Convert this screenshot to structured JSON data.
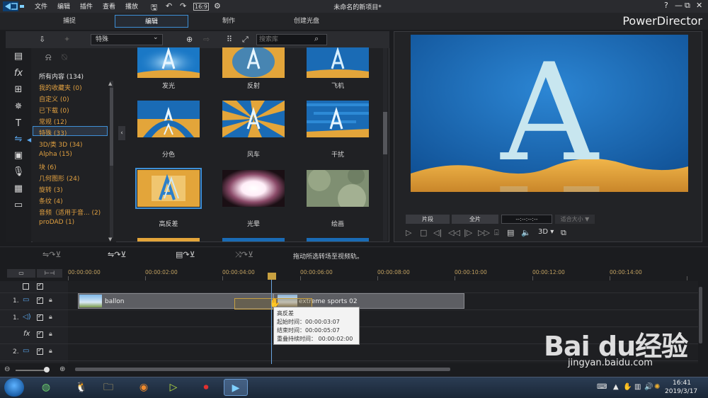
{
  "menu": {
    "items": [
      "文件",
      "编辑",
      "插件",
      "查看",
      "播放"
    ],
    "window_title": "未命名的新项目*",
    "win_controls": [
      "?",
      "—",
      "⧉",
      "✕"
    ]
  },
  "modes": {
    "tabs": [
      "捕捉",
      "编辑",
      "制作",
      "创建光盘"
    ],
    "brand": "PowerDirector"
  },
  "library": {
    "dropdown": "特殊",
    "search_placeholder": "搜索库",
    "categories": [
      {
        "label": "所有内容 (134)"
      },
      {
        "label": "我的收藏夹 (0)"
      },
      {
        "label": "自定义 (0)"
      },
      {
        "label": "已下载 (0)"
      },
      {
        "label": "常规 (12)"
      },
      {
        "label": "特殊 (33)"
      },
      {
        "label": "3D/类 3D (34)"
      },
      {
        "label": "Alpha (15)"
      },
      {
        "label": "块 (6)"
      },
      {
        "label": "几何图形 (24)"
      },
      {
        "label": "旋转 (3)"
      },
      {
        "label": "条纹 (4)"
      },
      {
        "label": "音频（适用于音... (2)"
      },
      {
        "label": "proDAD (1)"
      }
    ],
    "transitions": [
      {
        "label": "发光",
        "icon": "glow-transition-icon"
      },
      {
        "label": "反射",
        "icon": "reflection-transition-icon"
      },
      {
        "label": "飞机",
        "icon": "airplane-transition-icon"
      },
      {
        "label": "分色",
        "icon": "split-color-transition-icon"
      },
      {
        "label": "风车",
        "icon": "windmill-transition-icon"
      },
      {
        "label": "干扰",
        "icon": "interference-transition-icon"
      },
      {
        "label": "高反差",
        "icon": "high-contrast-transition-icon"
      },
      {
        "label": "光晕",
        "icon": "halo-transition-icon"
      },
      {
        "label": "绘画",
        "icon": "painting-transition-icon"
      }
    ]
  },
  "preview": {
    "letter": "A",
    "clip_btn": "片段",
    "movie_btn": "全片",
    "timecode": "--:--:--:--",
    "fit_size": "适合大小 ▼",
    "mode_3d": "3D ▾",
    "colors": {
      "sky": "#1a6bb5",
      "sand": "#e3a53a",
      "letter": "#c8e6ef"
    }
  },
  "timeline": {
    "hint": "拖动所选转场至视频轨。",
    "ruler": [
      "00:00:00:00",
      "00:00:02:00",
      "00:00:04:00",
      "00:00:06:00",
      "00:00:08:00",
      "00:00:10:00",
      "00:00:12:00",
      "00:00:14:00"
    ],
    "tracks": [
      {
        "num": "1.",
        "kind": "video"
      },
      {
        "num": "1.",
        "kind": "audio"
      },
      {
        "num": "",
        "kind": "fx"
      },
      {
        "num": "2.",
        "kind": "video"
      }
    ],
    "clip1": "ballon",
    "clip2": "extreme sports 02",
    "tooltip": {
      "title": "高反差",
      "start": "起始时间：00:00:03:07",
      "end": "结束时间：00:00:05:07",
      "overlap": "重叠持续时间： 00:00:02:00"
    }
  },
  "taskbar": {
    "time": "16:41",
    "date": "2019/3/17"
  },
  "watermark": {
    "logo": "Bai du经验",
    "url": "jingyan.baidu.com"
  }
}
